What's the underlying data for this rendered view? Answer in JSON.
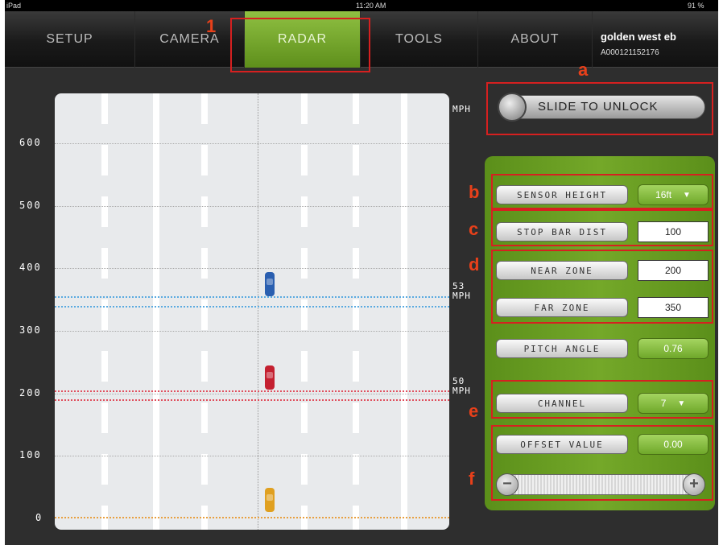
{
  "status": {
    "device": "iPad",
    "time": "11:20 AM",
    "battery": "91 %"
  },
  "tabs": [
    {
      "label": "SETUP",
      "active": false
    },
    {
      "label": "CAMERA",
      "active": false
    },
    {
      "label": "RADAR",
      "active": true
    },
    {
      "label": "TOOLS",
      "active": false
    },
    {
      "label": "ABOUT",
      "active": false
    }
  ],
  "device": {
    "name": "golden west eb",
    "id": "A000121152176"
  },
  "radar": {
    "y_ticks": [
      "600",
      "500",
      "400",
      "300",
      "200",
      "100",
      "0"
    ],
    "mph_top": "MPH",
    "speed_near": {
      "value": "53",
      "unit": "MPH"
    },
    "speed_far": {
      "value": "50",
      "unit": "MPH"
    },
    "cars": [
      {
        "name": "blue",
        "color": "#2a5fb0",
        "distance": 375
      },
      {
        "name": "red",
        "color": "#c42030",
        "distance": 225
      },
      {
        "name": "yellow",
        "color": "#e0a020",
        "distance": 30
      }
    ],
    "zone_lines": {
      "blue": [
        355,
        340
      ],
      "red": [
        205,
        190
      ],
      "orange": [
        3
      ]
    }
  },
  "controls": {
    "slide_to_unlock": "SLIDE TO UNLOCK",
    "sensor_height": {
      "label": "SENSOR HEIGHT",
      "value": "16ft"
    },
    "stop_bar_dist": {
      "label": "STOP BAR DIST",
      "value": "100"
    },
    "near_zone": {
      "label": "NEAR ZONE",
      "value": "200"
    },
    "far_zone": {
      "label": "FAR ZONE",
      "value": "350"
    },
    "pitch_angle": {
      "label": "PITCH ANGLE",
      "value": "0.76"
    },
    "channel": {
      "label": "CHANNEL",
      "value": "7"
    },
    "offset_value": {
      "label": "OFFSET VALUE",
      "value": "0.00"
    },
    "minus": "−",
    "plus": "+"
  },
  "annotations": [
    "1",
    "a",
    "b",
    "c",
    "d",
    "e",
    "f"
  ],
  "colors": {
    "active_tab": "#6fa328",
    "annotation": "#d62020",
    "panel": "#6a9e22"
  }
}
